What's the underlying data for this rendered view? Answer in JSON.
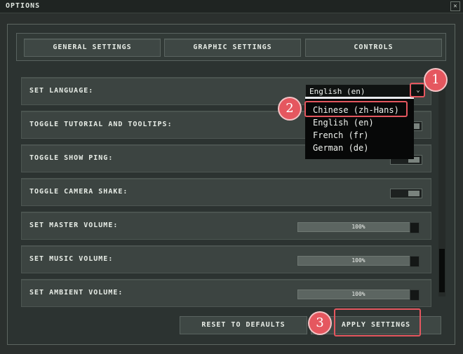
{
  "window": {
    "title": "OPTIONS",
    "close_icon": "close-icon"
  },
  "tabs": [
    {
      "label": "GENERAL SETTINGS"
    },
    {
      "label": "GRAPHIC SETTINGS"
    },
    {
      "label": "CONTROLS"
    }
  ],
  "settings": {
    "language": {
      "label": "SET LANGUAGE:",
      "value": "English (en)"
    },
    "tutorial": {
      "label": "TOGGLE TUTORIAL AND TOOLTIPS:"
    },
    "ping": {
      "label": "TOGGLE SHOW PING:"
    },
    "camera_shake": {
      "label": "TOGGLE CAMERA SHAKE:",
      "on": true
    },
    "master_volume": {
      "label": "SET MASTER VOLUME:",
      "value": "100%",
      "level": 1.0
    },
    "music_volume": {
      "label": "SET MUSIC VOLUME:",
      "value": "100%",
      "level": 1.0
    },
    "ambient_volume": {
      "label": "SET AMBIENT VOLUME:",
      "value": "100%",
      "level": 1.0
    }
  },
  "language_options": [
    "Chinese (zh-Hans)",
    "English (en)",
    "French (fr)",
    "German (de)"
  ],
  "buttons": {
    "reset": "RESET TO DEFAULTS",
    "apply": "APPLY SETTINGS"
  },
  "annotations": {
    "marker_1": "1",
    "marker_2": "2",
    "marker_3": "3",
    "color": "#e5575f"
  }
}
